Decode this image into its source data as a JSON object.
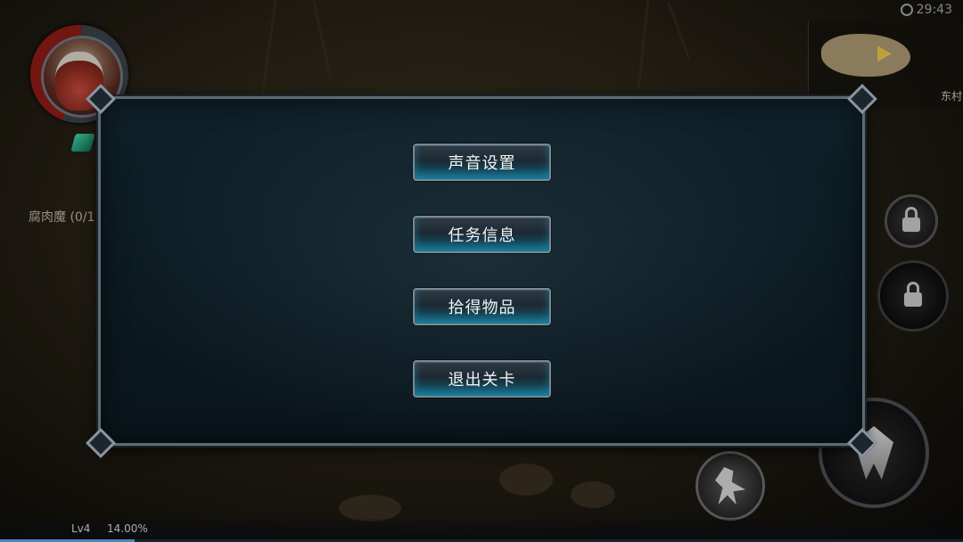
{
  "hud": {
    "clock": "29:43",
    "minimap_label": "东村",
    "quest_text": "腐肉魔 (0/1",
    "level": "Lv4",
    "exp_percent": "14.00%",
    "exp_fraction": 0.14
  },
  "menu": {
    "items": [
      {
        "label": "声音设置",
        "name": "sound-settings-button"
      },
      {
        "label": "任务信息",
        "name": "quest-info-button"
      },
      {
        "label": "拾得物品",
        "name": "picked-items-button"
      },
      {
        "label": "退出关卡",
        "name": "exit-level-button"
      }
    ]
  },
  "colors": {
    "modal_bg": "#0b1a21",
    "button_glow": "#28b4dc",
    "exp_fill": "#5ba8e0",
    "health_red": "#8d1a14"
  },
  "icons": [
    "clock-icon",
    "lock-icon",
    "attack-icon",
    "dance-skill-icon",
    "buff-icon"
  ]
}
